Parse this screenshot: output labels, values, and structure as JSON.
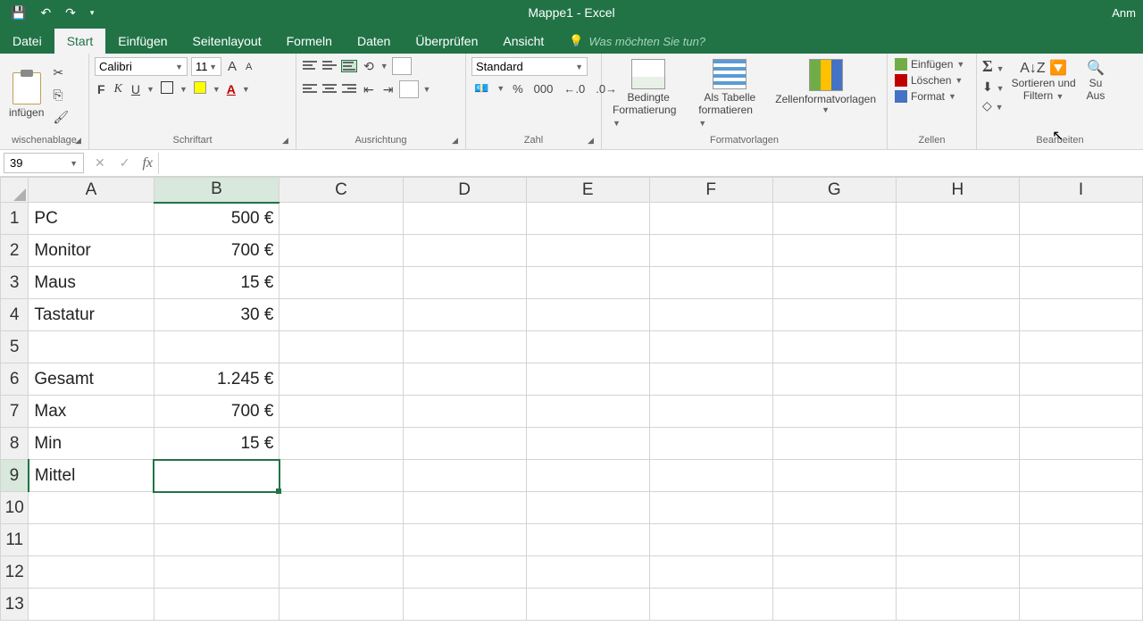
{
  "title": "Mappe1 - Excel",
  "titleRight": "Anm",
  "tabs": {
    "datei": "Datei",
    "start": "Start",
    "einfuegen": "Einfügen",
    "seitenlayout": "Seitenlayout",
    "formeln": "Formeln",
    "daten": "Daten",
    "ueberpruefen": "Überprüfen",
    "ansicht": "Ansicht",
    "tellme": "Was möchten Sie tun?"
  },
  "ribbon": {
    "clipboard": {
      "paste": "infügen",
      "label": "wischenablage"
    },
    "font": {
      "name": "Calibri",
      "size": "11",
      "label": "Schriftart"
    },
    "align": {
      "label": "Ausrichtung"
    },
    "number": {
      "format": "Standard",
      "label": "Zahl",
      "pct": "%",
      "thou": "000"
    },
    "styles": {
      "cond1": "Bedingte",
      "cond2": "Formatierung",
      "tbl1": "Als Tabelle",
      "tbl2": "formatieren",
      "cell": "Zellenformatvorlagen",
      "label": "Formatvorlagen"
    },
    "cells": {
      "ins": "Einfügen",
      "del": "Löschen",
      "fmt": "Format",
      "label": "Zellen"
    },
    "edit": {
      "sort1": "Sortieren und",
      "sort2": "Filtern",
      "find1": "Su",
      "find2": "Aus",
      "label": "Bearbeiten"
    }
  },
  "nameBox": "39",
  "columns": [
    "A",
    "B",
    "C",
    "D",
    "E",
    "F",
    "G",
    "H",
    "I"
  ],
  "rows": [
    {
      "n": "1",
      "a": "PC",
      "b": "500 €"
    },
    {
      "n": "2",
      "a": "Monitor",
      "b": "700 €"
    },
    {
      "n": "3",
      "a": "Maus",
      "b": "15 €"
    },
    {
      "n": "4",
      "a": "Tastatur",
      "b": "30 €"
    },
    {
      "n": "5",
      "a": "",
      "b": ""
    },
    {
      "n": "6",
      "a": "Gesamt",
      "b": "1.245 €"
    },
    {
      "n": "7",
      "a": "Max",
      "b": "700 €"
    },
    {
      "n": "8",
      "a": "Min",
      "b": "15 €"
    },
    {
      "n": "9",
      "a": "Mittel",
      "b": ""
    },
    {
      "n": "10",
      "a": "",
      "b": ""
    },
    {
      "n": "11",
      "a": "",
      "b": ""
    },
    {
      "n": "12",
      "a": "",
      "b": ""
    },
    {
      "n": "13",
      "a": "",
      "b": ""
    }
  ],
  "selectedCol": 1,
  "selectedRow": 8
}
